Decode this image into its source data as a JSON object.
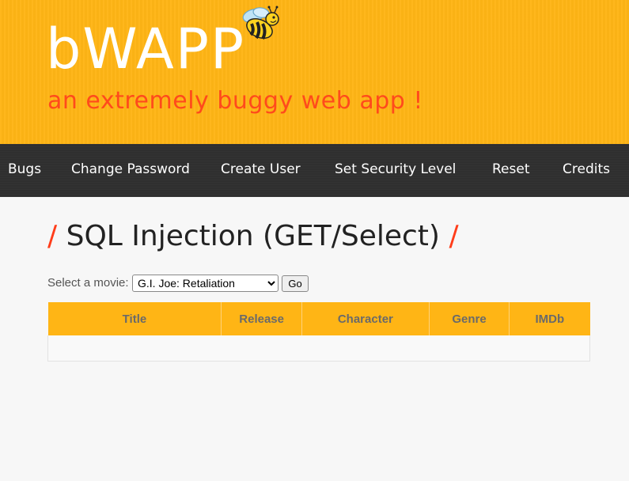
{
  "header": {
    "logo": "bWAPP",
    "tagline": "an extremely buggy web app !"
  },
  "menu": {
    "items": [
      {
        "label": "Bugs"
      },
      {
        "label": "Change Password"
      },
      {
        "label": "Create User"
      },
      {
        "label": "Set Security Level"
      },
      {
        "label": "Reset"
      },
      {
        "label": "Credits"
      }
    ]
  },
  "main": {
    "slash": "/",
    "title": "SQL Injection (GET/Select)",
    "select_label": "Select a movie:",
    "selected_movie": "G.I. Joe: Retaliation",
    "go_label": "Go",
    "table": {
      "columns": [
        "Title",
        "Release",
        "Character",
        "Genre",
        "IMDb"
      ]
    }
  },
  "colors": {
    "header_bg": "#ffb515",
    "menu_bg": "#2f2f2f",
    "tagline": "#ff4a1c",
    "accent_slash": "#ff3d1a"
  }
}
